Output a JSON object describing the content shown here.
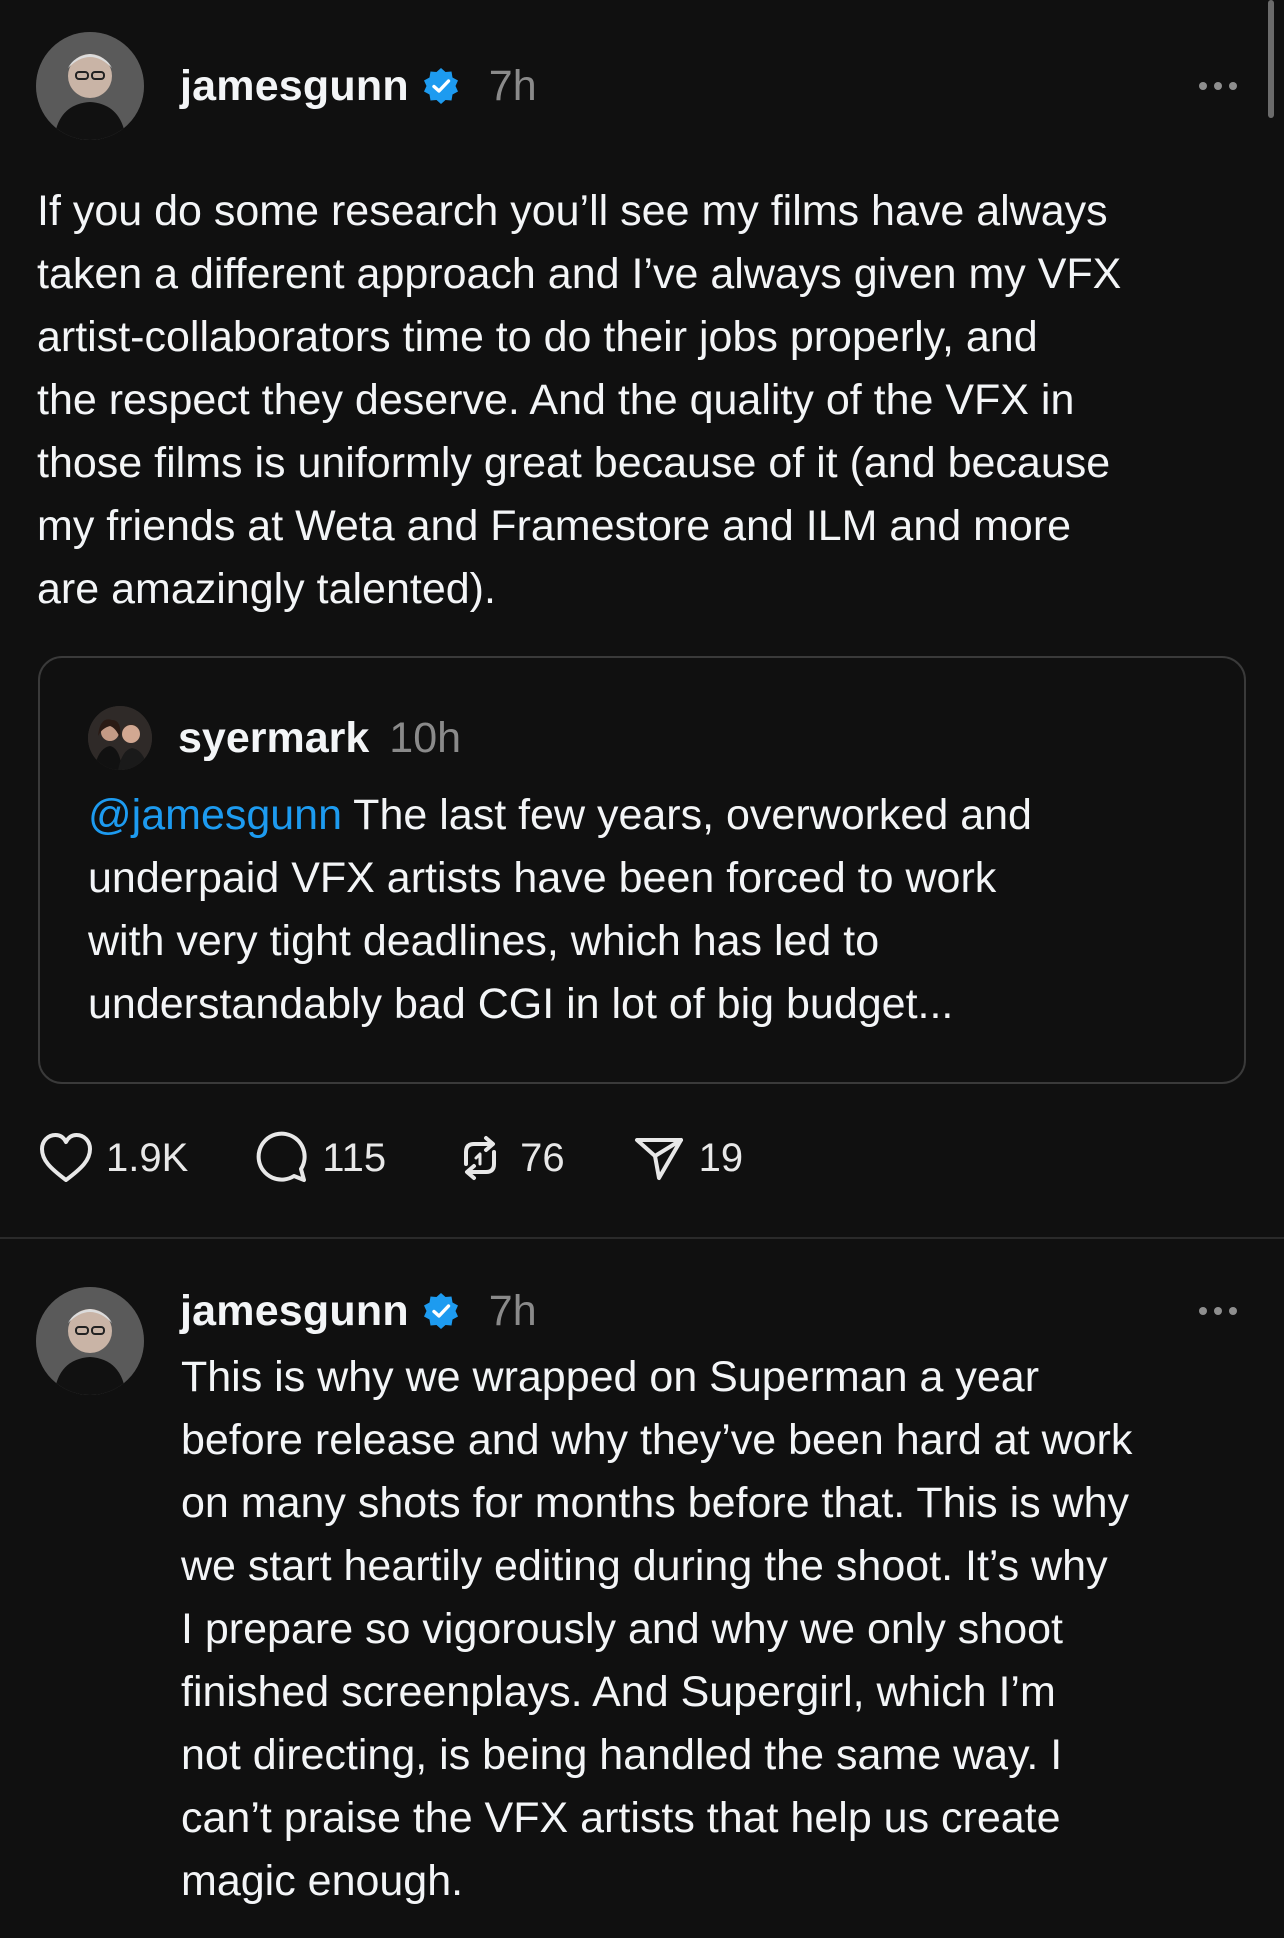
{
  "posts": [
    {
      "username": "jamesgunn",
      "time": "7h",
      "text": "If you do some research you’ll see my films have always\ntaken a different approach and I’ve always given my VFX\nartist-collaborators time to do their jobs properly, and\nthe respect they deserve. And the quality of the VFX in\nthose films is uniformly great because of it (and because\nmy friends at Weta and Framestore and ILM and more\nare amazingly talented).",
      "quote": {
        "username": "syermark",
        "time": "10h",
        "mention": "@jamesgunn",
        "text": " The last few years, overworked and\nunderpaid VFX artists have been forced to work\nwith very tight deadlines, which has led to\nunderstandably bad CGI in lot of big budget..."
      },
      "actions": {
        "likes": "1.9K",
        "replies": "115",
        "reposts": "76",
        "shares": "19"
      }
    },
    {
      "username": "jamesgunn",
      "time": "7h",
      "text": "This is why we wrapped on Superman a year\nbefore release and why they’ve been hard at work\non many shots for months before that. This is why\nwe start heartily editing during the shoot. It’s why\nI prepare so vigorously and why we only shoot\nfinished screenplays. And Supergirl, which I’m\nnot directing, is being handled the same way. I\ncan’t praise the VFX artists that help us create\nmagic enough."
    }
  ],
  "icons": {
    "verified": "verified-badge-icon",
    "more": "more-horizontal-icon",
    "like": "heart-icon",
    "reply": "comment-bubble-icon",
    "repost": "repost-icon",
    "share": "send-icon"
  },
  "colors": {
    "background": "#101010",
    "text": "#f3f5f7",
    "muted": "#8a8a8a",
    "verified": "#1d9bf0",
    "mention": "#1d9bf0",
    "border": "#3a3a3a"
  }
}
